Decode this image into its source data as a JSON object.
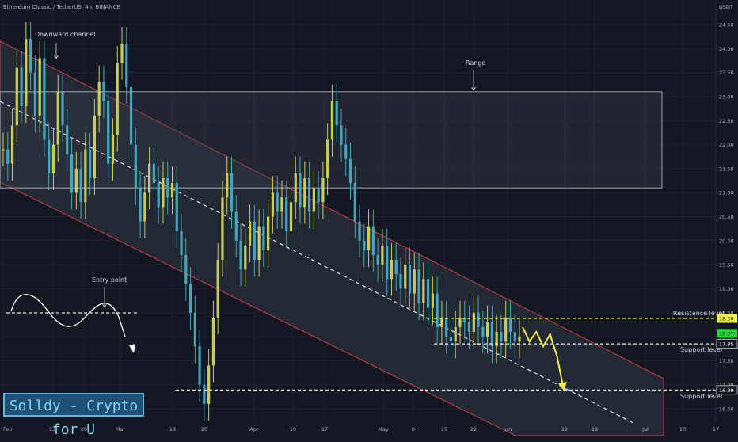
{
  "header": {
    "title": "Ethereum Classic / TetherUS, 4h, BINANCE"
  },
  "watermark": {
    "text": "Solldy - Crypto for U"
  },
  "colors": {
    "background": "#131722",
    "channel_border": "#d23b4b",
    "channel_fill": "#262b36",
    "range_fill": "#2a2e39",
    "dashed": "#e6e6e6",
    "candle_up": "#c9cc5b",
    "candle_down": "#3fa7bf",
    "projection": "#f5e94d",
    "price_highlight_yellow": "#fbf043",
    "price_highlight_green": "#25d63f"
  },
  "chart_data": {
    "type": "line",
    "title": "",
    "xlabel": "",
    "ylabel": "USDT",
    "ylim": [
      16.3,
      24.9
    ],
    "y_ticks": [
      "24.50",
      "24.00",
      "23.50",
      "23.00",
      "22.50",
      "22.00",
      "21.50",
      "21.00",
      "20.50",
      "20.00",
      "19.50",
      "19.00",
      "18.50",
      "18.00",
      "17.50",
      "17.00",
      "16.50"
    ],
    "x_ticks": [
      "Feb",
      "13",
      "20",
      "Mar",
      "13",
      "20",
      "Apr",
      "10",
      "17",
      "May",
      "8",
      "15",
      "22",
      "Jun",
      "12",
      "19",
      "Jul",
      "10",
      "17"
    ],
    "price_labels": [
      {
        "value": "18.38",
        "style": "yellow"
      },
      {
        "value": "18.07",
        "style": "green"
      },
      {
        "value": "17.85",
        "style": "plain"
      },
      {
        "value": "16.89",
        "style": "plain"
      }
    ],
    "annotations": {
      "downward_channel": "Downward channel",
      "range": "Range",
      "entry_point": "Entry point",
      "resistance": "Resistance level",
      "support_upper": "Support level",
      "support_lower": "Support level"
    },
    "series": [
      {
        "values": [
          21.9,
          21.6,
          22.4,
          23.6,
          22.8,
          24.2,
          23.5,
          22.6,
          23.8,
          22.1,
          21.4,
          22.0,
          23.1,
          22.4,
          21.8,
          21.0,
          21.5,
          20.8,
          21.9,
          21.3,
          22.6,
          23.3,
          22.9,
          21.6,
          22.2,
          23.7,
          24.1,
          23.2,
          22.0,
          21.1,
          20.4,
          21.0,
          21.6,
          21.2,
          20.7,
          21.3,
          20.9,
          21.2,
          20.2,
          19.7,
          19.1,
          18.5,
          17.8,
          17.0,
          16.6,
          17.4,
          18.4,
          19.6,
          20.9,
          21.4,
          20.6,
          20.0,
          19.4,
          19.9,
          20.4,
          19.6,
          20.3,
          19.8,
          20.5,
          21.0,
          20.6,
          20.9,
          20.2,
          20.8,
          21.4,
          20.7,
          21.3,
          20.6,
          21.1,
          20.8,
          21.3,
          22.1,
          22.9,
          22.4,
          22.0,
          21.7,
          21.2,
          20.4,
          20.0,
          19.8,
          20.3,
          19.7,
          19.5,
          19.9,
          19.2,
          19.6,
          19.3,
          19.0,
          19.5,
          18.9,
          19.4,
          18.7,
          19.2,
          18.6,
          18.9,
          18.2,
          18.4,
          18.0,
          17.9,
          18.2,
          18.4,
          18.3,
          18.1,
          18.5,
          18.2,
          18.0,
          18.3,
          17.8,
          18.1,
          17.9,
          18.4,
          18.1,
          17.9,
          18.0
        ]
      }
    ],
    "projection": [
      18.2,
      17.9,
      18.1,
      17.8,
      18.05,
      17.6,
      16.89
    ]
  }
}
